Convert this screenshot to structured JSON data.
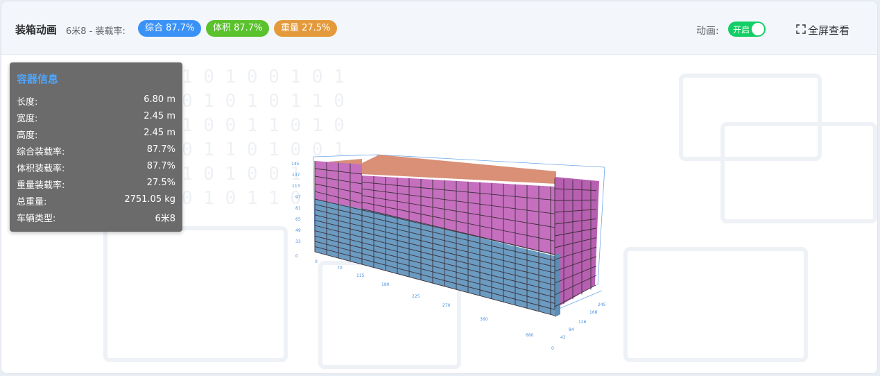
{
  "header": {
    "title": "装箱动画",
    "subtitle": "6米8 - 装载率:",
    "badges": [
      {
        "label": "综合 87.7%",
        "color": "#3a92f7"
      },
      {
        "label": "体积 87.7%",
        "color": "#5ac22c"
      },
      {
        "label": "重量 27.5%",
        "color": "#e49a3b"
      }
    ],
    "animation_label": "动画:",
    "animation_toggle": {
      "text": "开启",
      "on": true,
      "color": "#13ce66"
    },
    "fullscreen_label": "全屏查看",
    "fullscreen_icon": "expand-icon"
  },
  "info_panel": {
    "title": "容器信息",
    "rows": [
      {
        "label": "长度:",
        "value": "6.80 m"
      },
      {
        "label": "宽度:",
        "value": "2.45 m"
      },
      {
        "label": "高度:",
        "value": "2.45 m"
      },
      {
        "label": "综合装载率:",
        "value": "87.7%"
      },
      {
        "label": "体积装载率:",
        "value": "87.7%"
      },
      {
        "label": "重量装载率:",
        "value": "27.5%"
      },
      {
        "label": "总重量:",
        "value": "2751.05 kg"
      },
      {
        "label": "车辆类型:",
        "value": "6米8"
      }
    ]
  },
  "scene": {
    "box_colors": {
      "blue": "#6b9bc0",
      "pink": "#c66fbf",
      "orange": "#d99077",
      "grid": "#3a2f3a"
    },
    "axis_color": "#4a90e2"
  }
}
